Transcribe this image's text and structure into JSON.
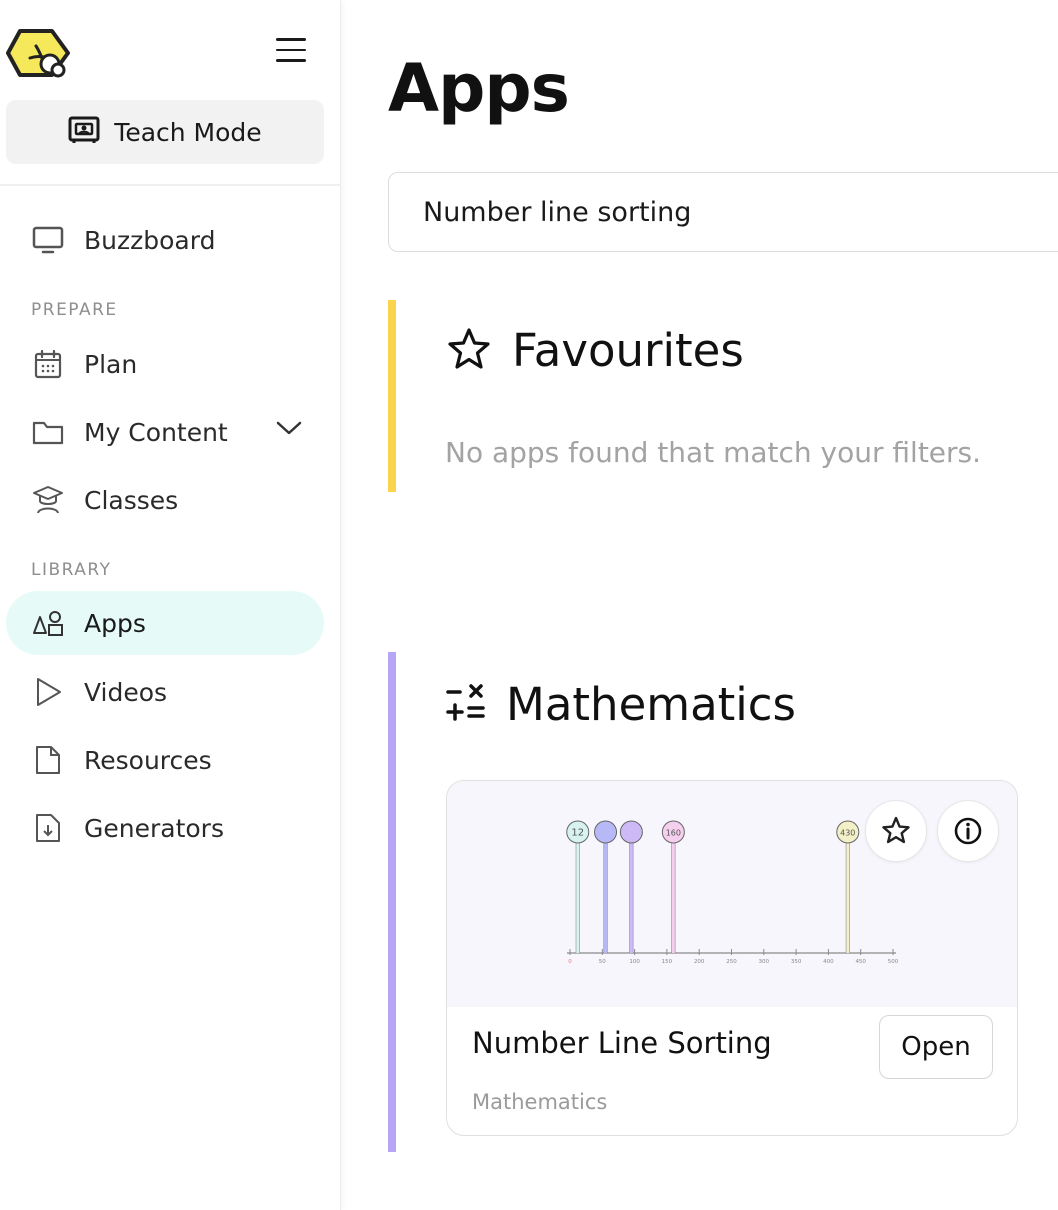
{
  "sidebar": {
    "logo_icon": "bee-hexagon-logo",
    "menu_icon": "hamburger-icon",
    "teach_mode_label": "Teach Mode",
    "buzzboard_label": "Buzzboard",
    "prepare_section": "PREPARE",
    "plan_label": "Plan",
    "my_content_label": "My Content",
    "classes_label": "Classes",
    "library_section": "LIBRARY",
    "apps_label": "Apps",
    "videos_label": "Videos",
    "resources_label": "Resources",
    "generators_label": "Generators",
    "active_item": "Apps"
  },
  "main": {
    "title": "Apps",
    "search": {
      "value": "Number line sorting"
    },
    "favourites": {
      "heading": "Favourites",
      "empty_message": "No apps found that match your filters.",
      "accent_color": "#f9d44c"
    },
    "mathematics": {
      "heading": "Mathematics",
      "accent_color": "#b6a6f5",
      "cards": [
        {
          "title": "Number Line Sorting",
          "subject": "Mathematics",
          "open_label": "Open",
          "thumbnail": {
            "axis_ticks": [
              "0",
              "50",
              "100",
              "150",
              "200",
              "250",
              "300",
              "350",
              "400",
              "450",
              "500"
            ],
            "pins": [
              {
                "value": 12,
                "label": "12",
                "color": "#d8f3ef"
              },
              {
                "value": 55,
                "label": "",
                "color": "#b7b9f7"
              },
              {
                "value": 95,
                "label": "",
                "color": "#cdb9f6"
              },
              {
                "value": 160,
                "label": "160",
                "color": "#f4d0ee"
              },
              {
                "value": 430,
                "label": "430",
                "color": "#f3f0c8"
              }
            ]
          }
        }
      ]
    }
  },
  "colors": {
    "active_nav_bg": "#e6fbf8",
    "logo_yellow": "#f5e85a"
  }
}
